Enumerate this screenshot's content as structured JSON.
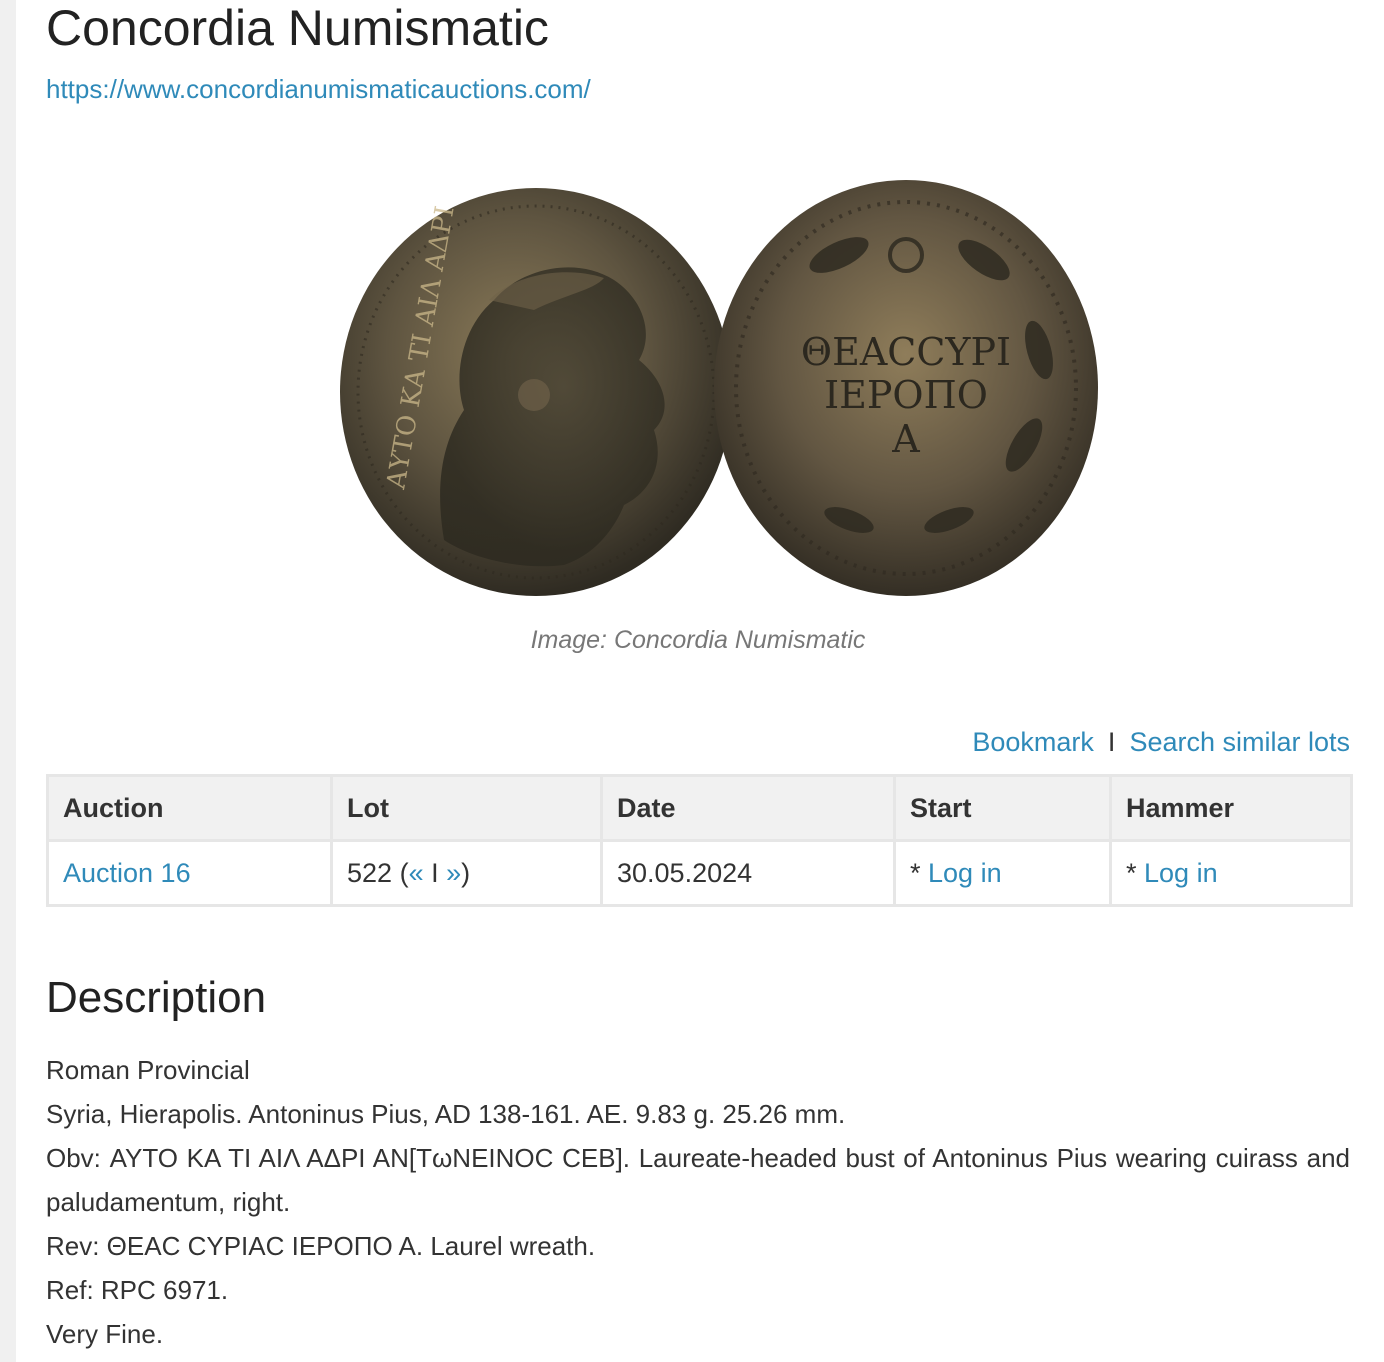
{
  "header": {
    "title": "Concordia Numismatic",
    "url": "https://www.concordianumismaticauctions.com/"
  },
  "image": {
    "caption": "Image: Concordia Numismatic",
    "obverse_legend": "ΑΥΤΟ ΚΑ ΤΙ ΑΙΛ ΑΔΡΙ",
    "reverse_legend_line1": "ΘΕΑCCΥΡΙ",
    "reverse_legend_line2": "ΙΕΡΟΠΟ",
    "reverse_legend_line3": "Α",
    "colors": {
      "bronze_dark": "#3f3a2c",
      "bronze_mid": "#6b5f45",
      "patina_light": "#a8946c"
    }
  },
  "actions": {
    "bookmark": "Bookmark",
    "separator": "I",
    "search_similar": "Search similar lots"
  },
  "lot_table": {
    "headers": {
      "auction": "Auction",
      "lot": "Lot",
      "date": "Date",
      "start": "Start",
      "hammer": "Hammer"
    },
    "row": {
      "auction": "Auction 16",
      "lot_number": "522",
      "lot_open": " (",
      "prev": "«",
      "lot_sep": " I ",
      "next": "»",
      "lot_close": ")",
      "date": "30.05.2024",
      "start_prefix": "* ",
      "start_link": "Log in",
      "hammer_prefix": "* ",
      "hammer_link": "Log in"
    }
  },
  "description": {
    "heading": "Description",
    "lines": [
      "Roman Provincial",
      "Syria, Hierapolis. Antoninus Pius, AD 138-161. AE. 9.83 g. 25.26 mm.",
      "Obv: ΑΥΤΟ ΚΑ ΤΙ ΑΙΛ ΑΔΡΙ ΑΝ[ΤωΝΕΙΝΟC CΕΒ]. Laureate-headed bust of Antoninus Pius wearing cuirass and paludamentum, right.",
      "Rev: ΘΕΑC CΥΡΙΑC ΙΕΡΟΠΟ Α. Laurel wreath.",
      "Ref: RPC 6971.",
      "Very Fine."
    ]
  },
  "theme": {
    "link_color": "#2f8ab9",
    "text_color": "#333333",
    "table_header_bg": "#f1f1f1",
    "table_border": "#e6e6e6"
  }
}
